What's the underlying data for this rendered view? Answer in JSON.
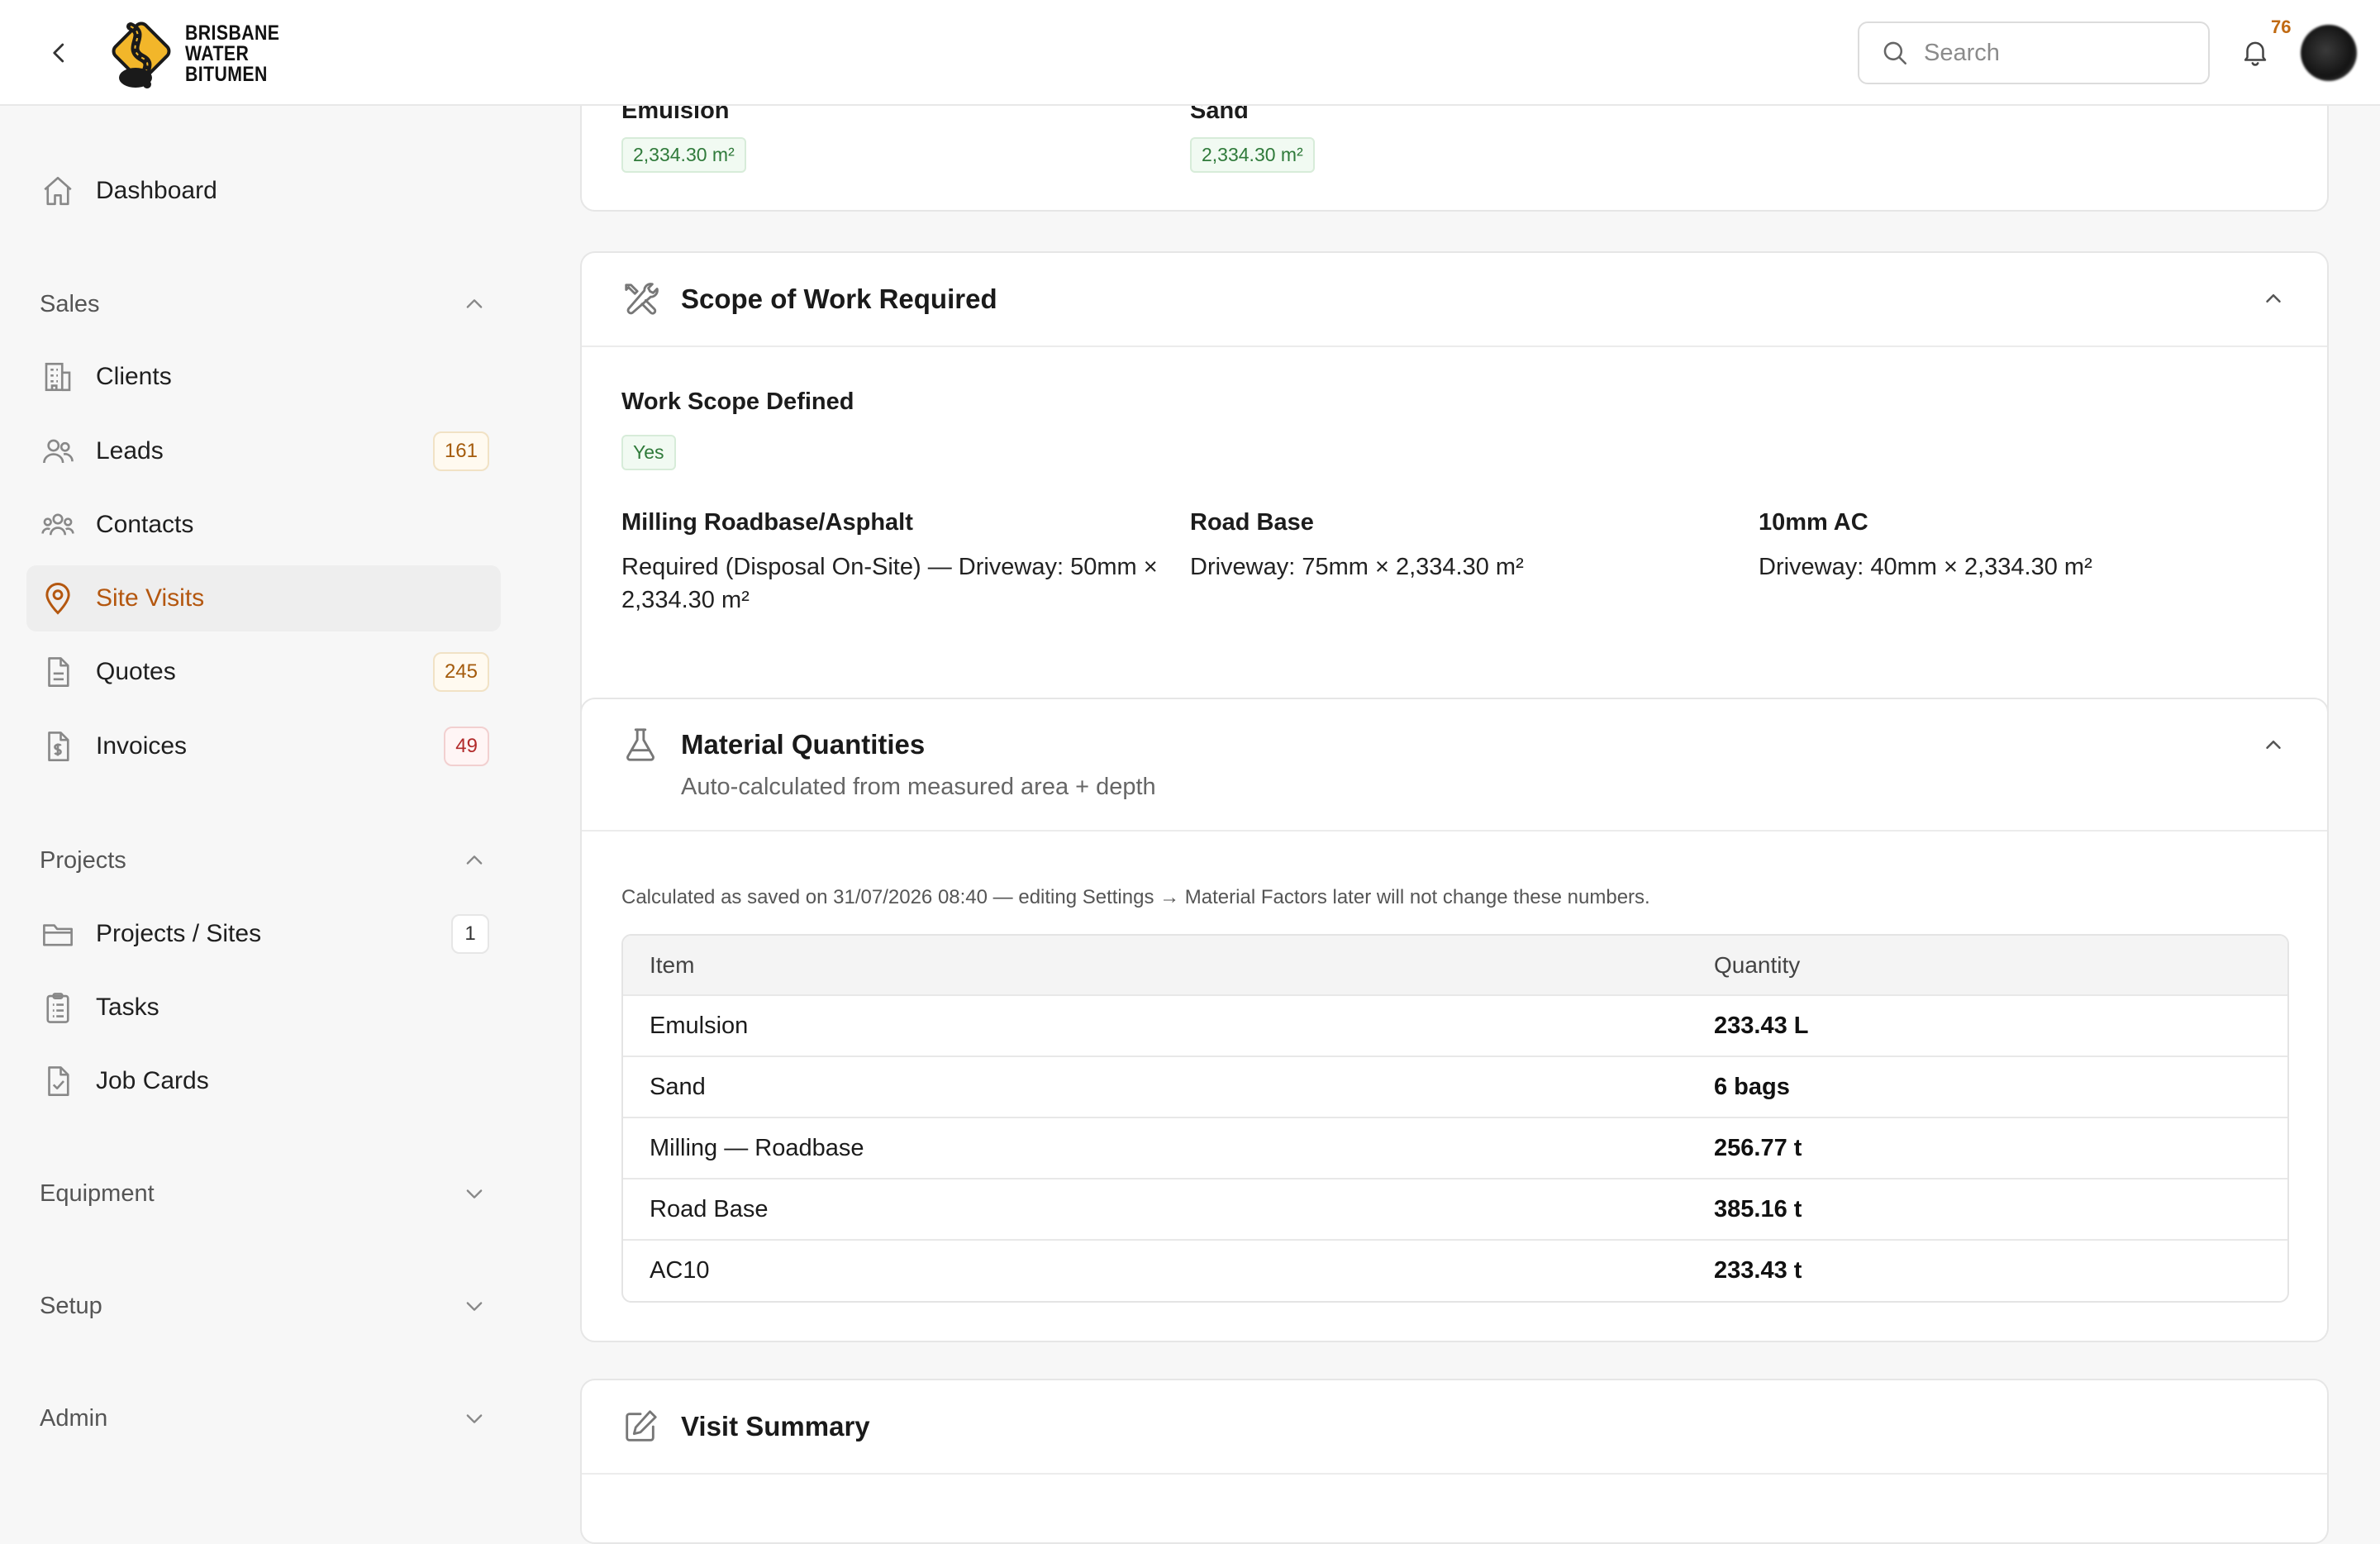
{
  "header": {
    "logo_lines": [
      "BRISBANE",
      "WATER",
      "BITUMEN"
    ],
    "search_placeholder": "Search",
    "notification_count": "76"
  },
  "sidebar": {
    "dashboard": "Dashboard",
    "sales_group": "Sales",
    "sales_items": [
      {
        "label": "Clients",
        "badge": ""
      },
      {
        "label": "Leads",
        "badge": "161"
      },
      {
        "label": "Contacts",
        "badge": ""
      },
      {
        "label": "Site Visits",
        "badge": ""
      },
      {
        "label": "Quotes",
        "badge": "245"
      },
      {
        "label": "Invoices",
        "badge": "49"
      }
    ],
    "projects_group": "Projects",
    "projects_items": [
      {
        "label": "Projects / Sites",
        "badge": "1"
      },
      {
        "label": "Tasks",
        "badge": ""
      },
      {
        "label": "Job Cards",
        "badge": ""
      }
    ],
    "equipment_group": "Equipment",
    "setup_group": "Setup",
    "admin_group": "Admin"
  },
  "areas_card": {
    "emulsion_label": "Emulsion",
    "emulsion_value": "2,334.30 m²",
    "sand_label": "Sand",
    "sand_value": "2,334.30 m²"
  },
  "scope_card": {
    "title": "Scope of Work Required",
    "defined_label": "Work Scope Defined",
    "defined_value": "Yes",
    "milling_label": "Milling Roadbase/Asphalt",
    "milling_value": "Required (Disposal On-Site) — Driveway: 50mm × 2,334.30 m²",
    "roadbase_label": "Road Base",
    "roadbase_value": "Driveway: 75mm × 2,334.30 m²",
    "ac_label": "10mm AC",
    "ac_value": "Driveway: 40mm × 2,334.30 m²"
  },
  "materials_card": {
    "title": "Material Quantities",
    "subtitle": "Auto-calculated from measured area + depth",
    "note": "Calculated as saved on 31/07/2026 08:40 — editing Settings → Material Factors later will not change these numbers.",
    "col_item": "Item",
    "col_qty": "Quantity",
    "rows": [
      {
        "item": "Emulsion",
        "qty": "233.43 L"
      },
      {
        "item": "Sand",
        "qty": "6 bags"
      },
      {
        "item": "Milling — Roadbase",
        "qty": "256.77 t"
      },
      {
        "item": "Road Base",
        "qty": "385.16 t"
      },
      {
        "item": "AC10",
        "qty": "233.43 t"
      }
    ]
  },
  "summary_card": {
    "title": "Visit Summary"
  },
  "colors": {
    "accent": "#b4570f",
    "logo_yellow": "#f2b62a",
    "pill_green": "#2f7a3a"
  }
}
